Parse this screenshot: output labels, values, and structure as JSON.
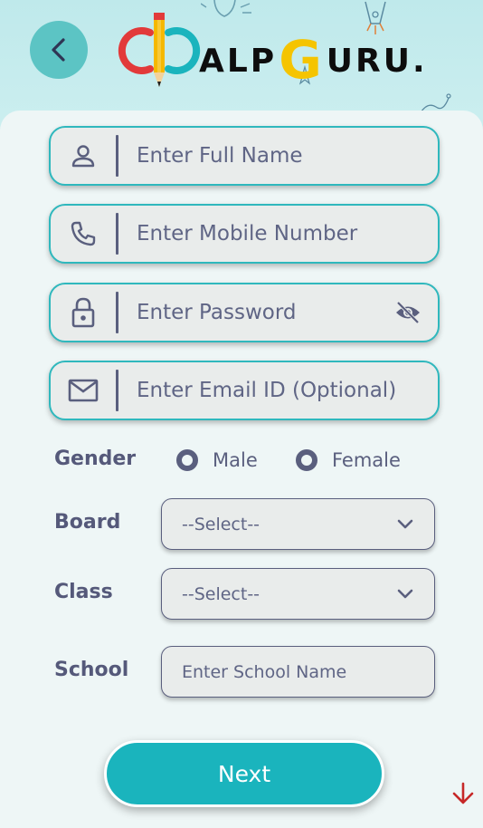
{
  "header": {
    "logo_text_prefix": "ALP",
    "logo_text_g": "G",
    "logo_text_suffix": "URU."
  },
  "form": {
    "full_name_placeholder": "Enter Full Name",
    "mobile_placeholder": "Enter Mobile Number",
    "password_placeholder": "Enter Password",
    "email_placeholder": "Enter Email ID (Optional)"
  },
  "gender": {
    "label": "Gender",
    "options": [
      "Male",
      "Female"
    ]
  },
  "board": {
    "label": "Board",
    "selected": "--Select--"
  },
  "class": {
    "label": "Class",
    "selected": "--Select--"
  },
  "school": {
    "label": "School",
    "placeholder": "Enter School Name"
  },
  "next_label": "Next",
  "colors": {
    "accent": "#1ab4bd",
    "field_border": "#2fb8bd",
    "text": "#5a5f7e",
    "logo_g": "#f5c400"
  },
  "icons": {
    "back": "chevron-left-icon",
    "person": "person-icon",
    "phone": "phone-icon",
    "lock": "lock-icon",
    "eye_off": "eye-off-icon",
    "mail": "mail-icon",
    "chevron_down": "chevron-down-icon",
    "arrow_down": "arrow-down-icon"
  }
}
